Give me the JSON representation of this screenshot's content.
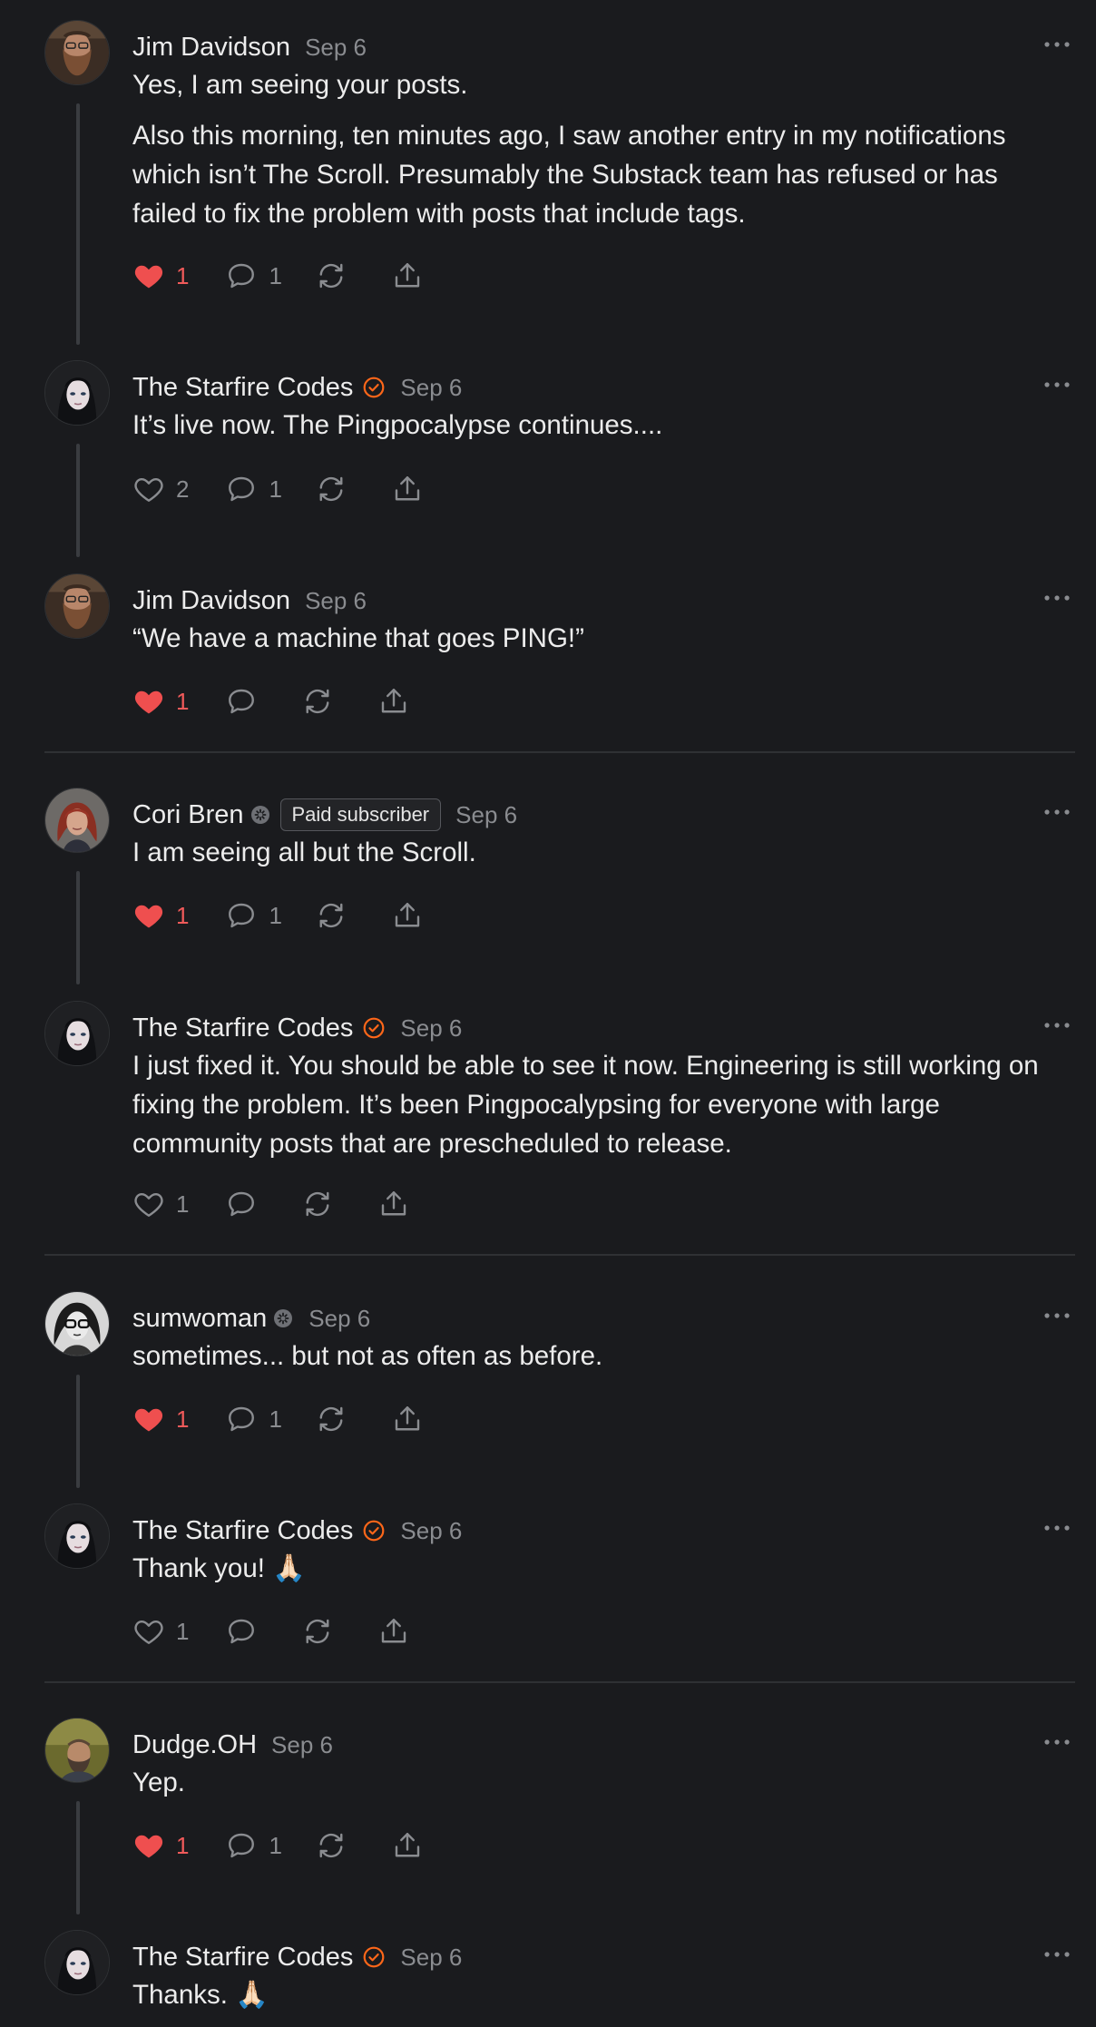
{
  "colors": {
    "background": "#1a1b1e",
    "text": "#ececec",
    "muted": "#8a8c90",
    "like_active": "#ef4f4f",
    "verified_badge": "#ff6719",
    "thread_line": "#3a3c40"
  },
  "comments": [
    {
      "author": "Jim Davidson",
      "date": "Sep 6",
      "avatar": "avatar-bearded-man",
      "badge": null,
      "paragraphs": [
        "Yes, I am seeing your posts.",
        "Also this morning, ten minutes ago, I saw another entry in my notifications which isn’t The Scroll. Presumably the Substack team has refused or has failed to fix the problem with posts that include tags."
      ],
      "likes": "1",
      "liked": true,
      "replies": "1"
    },
    {
      "author": "The Starfire Codes",
      "date": "Sep 6",
      "avatar": "avatar-dark-hair-woman",
      "badge": "verified-check-icon",
      "paragraphs": [
        "It’s live now. The Pingpocalypse continues...."
      ],
      "likes": "2",
      "liked": false,
      "replies": "1"
    },
    {
      "author": "Jim Davidson",
      "date": "Sep 6",
      "avatar": "avatar-bearded-man",
      "badge": null,
      "paragraphs": [
        "“We have a machine that goes PING!”"
      ],
      "likes": "1",
      "liked": true,
      "replies": ""
    },
    {
      "author": "Cori Bren",
      "date": "Sep 6",
      "avatar": "avatar-red-hair-woman",
      "badge": "subscriber-icon",
      "tag": "Paid subscriber",
      "paragraphs": [
        "I am seeing all but the Scroll."
      ],
      "likes": "1",
      "liked": true,
      "replies": "1"
    },
    {
      "author": "The Starfire Codes",
      "date": "Sep 6",
      "avatar": "avatar-dark-hair-woman",
      "badge": "verified-check-icon",
      "paragraphs": [
        "I just fixed it. You should be able to see it now. Engineering is still working on fixing the problem. It’s been Pingpocalypsing for everyone with large community posts that are prescheduled to release."
      ],
      "likes": "1",
      "liked": false,
      "replies": ""
    },
    {
      "author": "sumwoman",
      "date": "Sep 6",
      "avatar": "avatar-glasses-woman",
      "badge": "subscriber-icon",
      "paragraphs": [
        "sometimes... but not as often as before."
      ],
      "likes": "1",
      "liked": true,
      "replies": "1"
    },
    {
      "author": "The Starfire Codes",
      "date": "Sep 6",
      "avatar": "avatar-dark-hair-woman",
      "badge": "verified-check-icon",
      "paragraphs": [
        "Thank you! 🙏🏻"
      ],
      "likes": "1",
      "liked": false,
      "replies": ""
    },
    {
      "author": "Dudge.OH",
      "date": "Sep 6",
      "avatar": "avatar-man-outdoors",
      "badge": null,
      "paragraphs": [
        "Yep."
      ],
      "likes": "1",
      "liked": true,
      "replies": "1"
    },
    {
      "author": "The Starfire Codes",
      "date": "Sep 6",
      "avatar": "avatar-dark-hair-woman",
      "badge": "verified-check-icon",
      "paragraphs": [
        "Thanks. 🙏🏻"
      ],
      "likes": "",
      "liked": false,
      "replies": ""
    }
  ]
}
